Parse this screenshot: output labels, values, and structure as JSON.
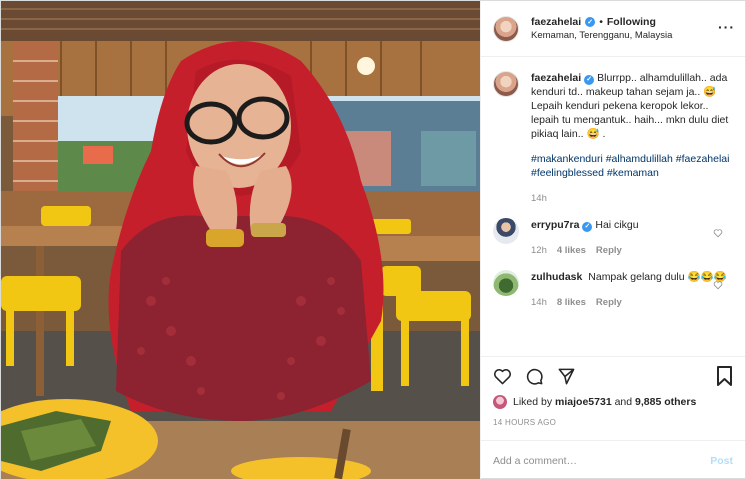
{
  "header": {
    "username": "faezahelai",
    "separator": "•",
    "follow_status": "Following",
    "location": "Kemaman, Terengganu, Malaysia",
    "more_icon": "more-horizontal-icon"
  },
  "caption": {
    "username": "faezahelai",
    "text": "Blurrpp.. alhamdulillah.. ada kenduri td.. makeup tahan sejam ja.. 😅 Lepaih kenduri pekena keropok lekor.. lepaih tu mengantuk.. haih... mkn dulu diet pikiaq lain.. 😅 .",
    "hashtags": "#makankenduri #alhamdulillah #faezahelai #feelingblessed #kemaman",
    "age": "14h"
  },
  "comments": [
    {
      "username": "errypu7ra",
      "text": "Hai cikgu",
      "age": "12h",
      "likes": "4 likes",
      "reply": "Reply"
    },
    {
      "username": "zulhudask",
      "text": "Nampak gelang dulu 😂😂😂",
      "age": "14h",
      "likes": "8 likes",
      "reply": "Reply"
    }
  ],
  "actions": {
    "liked_prefix": "Liked by",
    "liked_user": "miajoe5731",
    "liked_and": "and",
    "liked_others": "9,885 others",
    "timestamp": "14 HOURS AGO"
  },
  "add_comment": {
    "placeholder": "Add a comment…",
    "post_label": "Post"
  },
  "colors": {
    "link": "#003569",
    "verified": "#3897f0",
    "post_disabled": "#b2dffc",
    "muted": "#8e8e8e"
  }
}
